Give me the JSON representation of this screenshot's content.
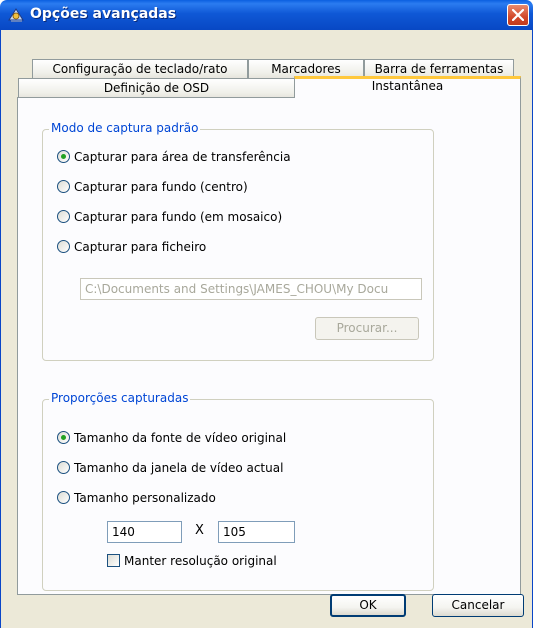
{
  "window": {
    "title": "Opções avançadas",
    "close_icon": "close-icon"
  },
  "tabs": {
    "row1": [
      "Configuração de teclado/rato",
      "Marcadores",
      "Barra de ferramentas"
    ],
    "row2": [
      "Definição de OSD",
      "Instantânea"
    ],
    "active": "Instantânea"
  },
  "capture_mode": {
    "legend": "Modo de captura padrão",
    "options": [
      "Capturar para área de transferência",
      "Capturar para fundo (centro)",
      "Capturar para fundo (em mosaico)",
      "Capturar para ficheiro"
    ],
    "selected_index": 0,
    "path_value": "C:\\Documents and Settings\\JAMES_CHOU\\My Docu",
    "browse_label": "Procurar..."
  },
  "proportions": {
    "legend": "Proporções capturadas",
    "options": [
      "Tamanho da fonte de vídeo original",
      "Tamanho da janela de vídeo actual",
      "Tamanho personalizado"
    ],
    "selected_index": 0,
    "width_value": "140",
    "separator": "X",
    "height_value": "105",
    "keep_resolution_label": "Manter resolução original",
    "keep_resolution_checked": false
  },
  "footer": {
    "ok_label": "OK",
    "cancel_label": "Cancelar"
  },
  "colors": {
    "accent": "#0046d5",
    "title_bar": "#0a54d8",
    "radio_dot": "#21a121",
    "tab_highlight": "#ffc83c"
  }
}
